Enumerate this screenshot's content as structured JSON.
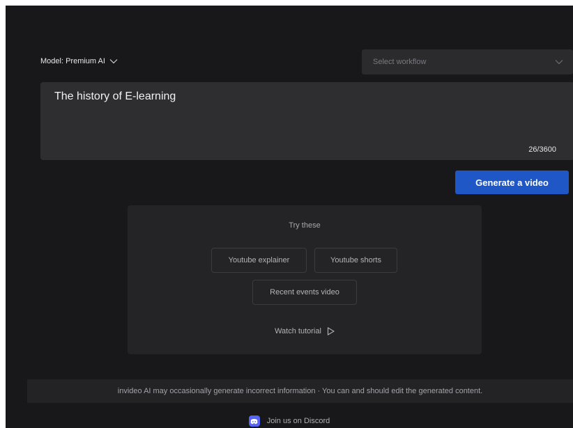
{
  "model": {
    "label": "Model: Premium AI"
  },
  "workflow": {
    "placeholder": "Select workflow"
  },
  "prompt": {
    "text": "The history of E-learning",
    "char_count": "26/3600"
  },
  "actions": {
    "generate_label": "Generate a video"
  },
  "suggestions": {
    "title": "Try these",
    "chips": [
      {
        "label": "Youtube explainer"
      },
      {
        "label": "Youtube shorts"
      },
      {
        "label": "Recent events video"
      }
    ],
    "watch_label": "Watch tutorial"
  },
  "footer": {
    "disclaimer": "invideo AI may occasionally generate incorrect information · You can and should edit the generated content.",
    "discord_label": "Join us on Discord"
  },
  "colors": {
    "background": "#18181a",
    "accent": "#1f57c7",
    "discord": "#5865f2"
  },
  "icons": {
    "model_chevron": "chevron-down-icon",
    "workflow_chevron": "chevron-down-icon",
    "watch": "play-icon",
    "discord": "discord-icon"
  }
}
